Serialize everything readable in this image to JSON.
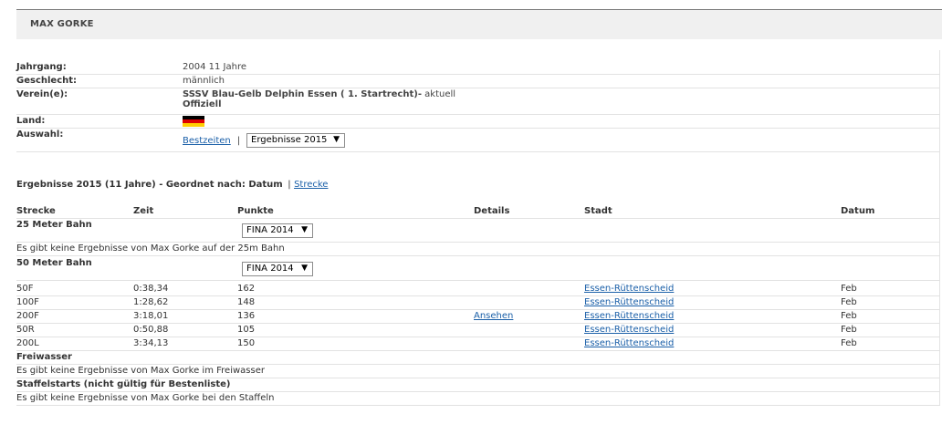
{
  "header": {
    "title": "MAX GORKE"
  },
  "info": {
    "jahrgang_label": "Jahrgang:",
    "jahrgang_value": "2004 11 Jahre",
    "geschlecht_label": "Geschlecht:",
    "geschlecht_value": "männlich",
    "verein_label": "Verein(e):",
    "verein_name": "SSSV Blau-Gelb Delphin Essen ( 1. Startrecht)-",
    "verein_status": " aktuell",
    "verein_offiziell": "Offiziell",
    "land_label": "Land:",
    "land_flag": "germany-flag",
    "auswahl_label": "Auswahl:",
    "bestzeiten_link": "Bestzeiten",
    "separator": "|",
    "ergebnisse_select": "Ergebnisse 2015"
  },
  "results": {
    "title": "Ergebnisse 2015 (11 Jahre) - Geordnet nach: Datum",
    "title_sep": "|",
    "strecke_link": "Strecke",
    "headers": {
      "strecke": "Strecke",
      "zeit": "Zeit",
      "punkte": "Punkte",
      "details": "Details",
      "stadt": "Stadt",
      "datum": "Datum"
    },
    "bahn25": {
      "title": "25 Meter Bahn",
      "select": "FINA 2014",
      "empty": "Es gibt keine Ergebnisse von Max Gorke auf der 25m Bahn"
    },
    "bahn50": {
      "title": "50 Meter Bahn",
      "select": "FINA 2014",
      "rows": [
        {
          "strecke": "50F",
          "zeit": "0:38,34",
          "punkte": "162",
          "details": "",
          "stadt": "Essen-Rüttenscheid",
          "datum": "Feb"
        },
        {
          "strecke": "100F",
          "zeit": "1:28,62",
          "punkte": "148",
          "details": "",
          "stadt": "Essen-Rüttenscheid",
          "datum": "Feb"
        },
        {
          "strecke": "200F",
          "zeit": "3:18,01",
          "punkte": "136",
          "details": "Ansehen",
          "stadt": "Essen-Rüttenscheid",
          "datum": "Feb"
        },
        {
          "strecke": "50R",
          "zeit": "0:50,88",
          "punkte": "105",
          "details": "",
          "stadt": "Essen-Rüttenscheid",
          "datum": "Feb"
        },
        {
          "strecke": "200L",
          "zeit": "3:34,13",
          "punkte": "150",
          "details": "",
          "stadt": "Essen-Rüttenscheid",
          "datum": "Feb"
        }
      ]
    },
    "freiwasser": {
      "title": "Freiwasser",
      "empty": "Es gibt keine Ergebnisse von Max Gorke im Freiwasser"
    },
    "staffel": {
      "title": "Staffelstarts (nicht gültig für Bestenliste)",
      "empty": "Es gibt keine Ergebnisse von Max Gorke bei den Staffeln"
    }
  }
}
